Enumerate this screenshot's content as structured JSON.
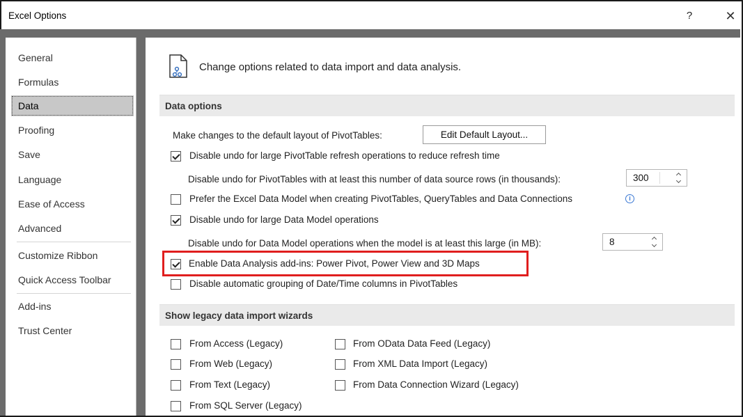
{
  "window": {
    "title": "Excel Options",
    "help_glyph": "?",
    "close_glyph": "✕"
  },
  "sidebar": {
    "items": [
      {
        "label": "General"
      },
      {
        "label": "Formulas"
      },
      {
        "label": "Data"
      },
      {
        "label": "Proofing"
      },
      {
        "label": "Save"
      },
      {
        "label": "Language"
      },
      {
        "label": "Ease of Access"
      },
      {
        "label": "Advanced"
      },
      {
        "label": "Customize Ribbon"
      },
      {
        "label": "Quick Access Toolbar"
      },
      {
        "label": "Add-ins"
      },
      {
        "label": "Trust Center"
      }
    ],
    "selected": "Data"
  },
  "header": {
    "text": "Change options related to data import and data analysis.",
    "icon": "data-document-icon"
  },
  "data_options": {
    "title": "Data options",
    "pivot_layout_label": "Make changes to the default layout of PivotTables:",
    "edit_layout_button": "Edit Default Layout...",
    "disable_undo_pivot_label": "Disable undo for large PivotTable refresh operations to reduce refresh time",
    "disable_undo_pivot_checked": true,
    "pivot_rows_label": "Disable undo for PivotTables with at least this number of data source rows (in thousands):",
    "pivot_rows_value": "300",
    "prefer_data_model_label": "Prefer the Excel Data Model when creating PivotTables, QueryTables and Data Connections",
    "prefer_data_model_checked": false,
    "disable_undo_model_label": "Disable undo for large Data Model operations",
    "disable_undo_model_checked": true,
    "model_size_label": "Disable undo for Data Model operations when the model is at least this large (in MB):",
    "model_size_value": "8",
    "enable_addins_label": "Enable Data Analysis add-ins: Power Pivot, Power View and 3D Maps",
    "enable_addins_checked": true,
    "disable_grouping_label": "Disable automatic grouping of Date/Time columns in PivotTables",
    "disable_grouping_checked": false
  },
  "legacy": {
    "title": "Show legacy data import wizards",
    "left": [
      {
        "label": "From Access (Legacy)",
        "checked": false
      },
      {
        "label": "From Web (Legacy)",
        "checked": false
      },
      {
        "label": "From Text (Legacy)",
        "checked": false
      },
      {
        "label": "From SQL Server (Legacy)",
        "checked": false
      }
    ],
    "right": [
      {
        "label": "From OData Data Feed (Legacy)",
        "checked": false
      },
      {
        "label": "From XML Data Import (Legacy)",
        "checked": false
      },
      {
        "label": "From Data Connection Wizard (Legacy)",
        "checked": false
      }
    ]
  },
  "colors": {
    "highlight": "#e01e1e",
    "selected_nav": "#c8c8c8",
    "section_header": "#eaeaea",
    "frame": "#6b6b6b"
  }
}
